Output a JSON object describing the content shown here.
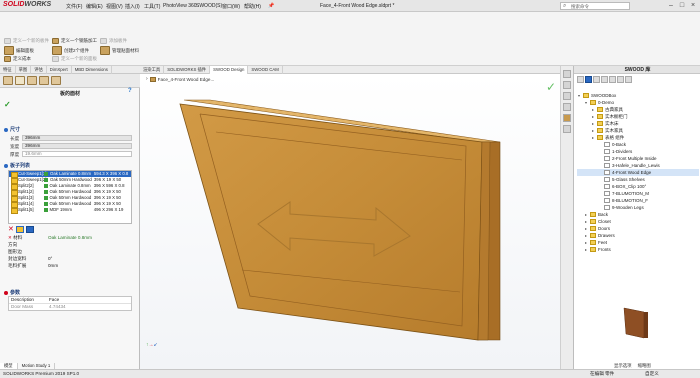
{
  "app": {
    "logo_brand": "SOLID",
    "logo_suffix": "WORKS",
    "menus": [
      "文件(F)",
      "编辑(E)",
      "视图(V)",
      "插入(I)",
      "工具(T)",
      "PhotoView 360",
      "SWOOD(S)",
      "窗口(W)",
      "帮助(H)"
    ],
    "document_title": "Face_4-Front Wood Edge.sldprt *",
    "search_placeholder": "搜索命令"
  },
  "command_bar": {
    "row1": [
      "定义一个新的板件",
      "定义一个钢筋加工",
      "添加板件"
    ],
    "row2": [
      "编辑面板",
      "创建2个组件",
      "管理贴面材料"
    ],
    "row3": [
      "定义成本",
      "定义一个新的面板"
    ]
  },
  "left_tabs": [
    "特征",
    "草图",
    "评估",
    "DimXpert",
    "MBD Dimensions",
    "渲染工具",
    "SOLIDWORKS 插件",
    "SWOOD Design",
    "SWOOD CAM"
  ],
  "property_manager": {
    "title": "板的面材",
    "help_icon": "?",
    "dimensions_header": "尺寸",
    "length_label": "长度",
    "length_value": "396mm",
    "width_label": "宽度",
    "width_value": "396mm",
    "thickness_label": "厚度",
    "thickness_value": "19.6mm",
    "bodies_header": "板子列表",
    "bodies": [
      {
        "name": "Cut-Sweep1[1]",
        "material": "Oak Laminate 0.8mm",
        "size": "594.3 X 396 X 0.8",
        "selected": true
      },
      {
        "name": "Cut-Sweep1[2]",
        "material": "Oak 50mm Hardwood",
        "size": "396 X 19 X 50",
        "selected": false
      },
      {
        "name": "Split2[2]",
        "material": "Oak Laminate 0.8mm",
        "size": "396 X 596 X 0.8",
        "selected": false
      },
      {
        "name": "Split1[2]",
        "material": "Oak 50mm Hardwood",
        "size": "396 X 19 X 50",
        "selected": false
      },
      {
        "name": "Split1[3]",
        "material": "Oak 50mm Hardwood",
        "size": "396 X 19 X 50",
        "selected": false
      },
      {
        "name": "Split1[4]",
        "material": "Oak 50mm Hardwood",
        "size": "396 X 19 X 50",
        "selected": false
      },
      {
        "name": "Split1[5]",
        "material": "MDF 19mm",
        "size": "496 X 296 X 19",
        "selected": false
      }
    ],
    "material_label": "材料",
    "material_value": "Oak Laminate 0.8mm",
    "direction_label": "方向",
    "unknown_label": "图形边",
    "edge_thickness_label": "封边宽料",
    "edge_thickness_value": "0°",
    "edge_extension_label": "毛料扩展",
    "edge_extension_value": "0mm",
    "params_header": "参数",
    "param_rows": [
      {
        "key": "Description",
        "value": "Face"
      },
      {
        "key": "Door Mass",
        "value": "4.74434"
      }
    ]
  },
  "viewport": {
    "breadcrumb": "Face_4-Front Wood Edge...",
    "bottom_tabs": [
      "模型",
      "Motion Study 1"
    ]
  },
  "right_panel": {
    "title": "SWOOD 库",
    "tree": [
      {
        "label": "SWOODBox",
        "depth": 0,
        "type": "root"
      },
      {
        "label": "0-Demo",
        "depth": 1,
        "type": "folder"
      },
      {
        "label": "古典家具",
        "depth": 2,
        "type": "folder"
      },
      {
        "label": "实木橱柜门",
        "depth": 2,
        "type": "folder"
      },
      {
        "label": "实木床",
        "depth": 2,
        "type": "folder"
      },
      {
        "label": "实木家具",
        "depth": 2,
        "type": "folder"
      },
      {
        "label": "表格 组件",
        "depth": 2,
        "type": "folder"
      },
      {
        "label": "0-Back",
        "depth": 3,
        "type": "part"
      },
      {
        "label": "1-Dividers",
        "depth": 3,
        "type": "part"
      },
      {
        "label": "2-Front Multiple Inside",
        "depth": 3,
        "type": "part"
      },
      {
        "label": "3-Hafele_Handle_Lewis",
        "depth": 3,
        "type": "part"
      },
      {
        "label": "4-Front Wood Edge",
        "depth": 3,
        "type": "part",
        "highlight": true
      },
      {
        "label": "5-Glass Shelves",
        "depth": 3,
        "type": "part"
      },
      {
        "label": "6-BOX_Clip 100°",
        "depth": 3,
        "type": "part"
      },
      {
        "label": "7-BLUMOTION_M",
        "depth": 3,
        "type": "part"
      },
      {
        "label": "8-BLUMOTION_F",
        "depth": 3,
        "type": "part"
      },
      {
        "label": "9-Wooden Legs",
        "depth": 3,
        "type": "part"
      },
      {
        "label": "Back",
        "depth": 1,
        "type": "folder"
      },
      {
        "label": "Closet",
        "depth": 1,
        "type": "folder"
      },
      {
        "label": "Doors",
        "depth": 1,
        "type": "folder"
      },
      {
        "label": "Drawers",
        "depth": 1,
        "type": "folder"
      },
      {
        "label": "Feet",
        "depth": 1,
        "type": "folder"
      },
      {
        "label": "Fronts",
        "depth": 1,
        "type": "folder"
      }
    ],
    "footer_tabs": [
      "显示选项",
      "缩略图"
    ]
  },
  "status": {
    "version": "SOLIDWORKS Premium 2019 SP1.0",
    "right_text": "在编辑 零件",
    "units": "自定义"
  },
  "colors": {
    "wood_face": "#c8903a",
    "wood_edge": "#a8702a",
    "select_blue": "#2a68c2",
    "brand_red": "#d0021b"
  }
}
